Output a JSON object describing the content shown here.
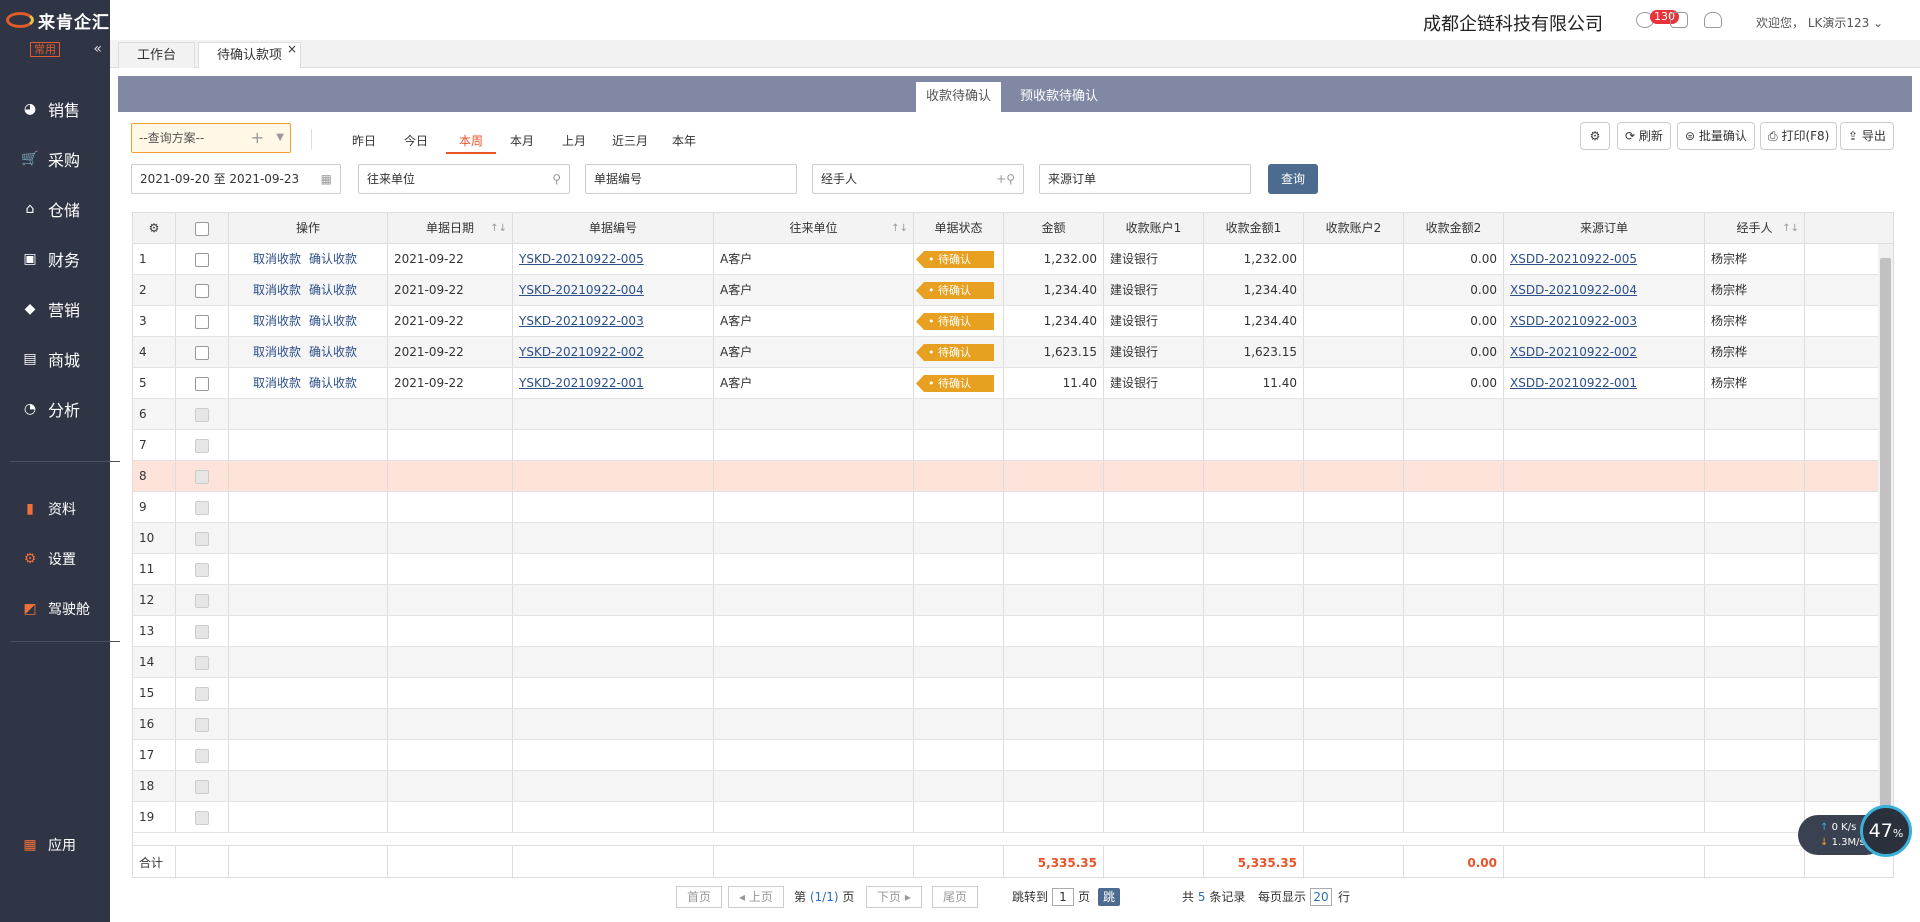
{
  "sidebar": {
    "logo": "来肯企汇",
    "fav": "常用",
    "items": [
      {
        "label": "销售",
        "icon": "sales-icon"
      },
      {
        "label": "采购",
        "icon": "purchase-icon"
      },
      {
        "label": "仓储",
        "icon": "warehouse-icon"
      },
      {
        "label": "财务",
        "icon": "finance-icon"
      },
      {
        "label": "营销",
        "icon": "marketing-icon"
      },
      {
        "label": "商城",
        "icon": "mall-icon"
      },
      {
        "label": "分析",
        "icon": "analysis-icon"
      }
    ],
    "items2": [
      {
        "label": "资料"
      },
      {
        "label": "设置"
      },
      {
        "label": "驾驶舱"
      }
    ],
    "app": "应用"
  },
  "header": {
    "company": "成都企链科技有限公司",
    "msg_count": "130",
    "welcome": "欢迎您，",
    "user": "LK演示123"
  },
  "tabs": [
    {
      "label": "工作台"
    },
    {
      "label": "待确认款项"
    }
  ],
  "panel_tabs": [
    {
      "label": "收款待确认"
    },
    {
      "label": "预收款待确认"
    }
  ],
  "toolbar": {
    "scheme": "--查询方案--",
    "quick": [
      "昨日",
      "今日",
      "本周",
      "本月",
      "上月",
      "近三月",
      "本年"
    ],
    "refresh": "刷新",
    "batch": "批量确认",
    "print": "打印(F8)",
    "export": "导出"
  },
  "filters": {
    "date_from": "2021-09-20",
    "date_sep": "至",
    "date_to": "2021-09-23",
    "partner": "往来单位",
    "bill_no": "单据编号",
    "handler": "经手人",
    "source": "来源订单",
    "query": "查询"
  },
  "columns": [
    "操作",
    "单据日期",
    "单据编号",
    "往来单位",
    "单据状态",
    "金额",
    "收款账户1",
    "收款金额1",
    "收款账户2",
    "收款金额2",
    "来源订单",
    "经手人"
  ],
  "actions": {
    "cancel": "取消收款",
    "confirm": "确认收款"
  },
  "rows": [
    {
      "date": "2021-09-22",
      "no": "YSKD-20210922-005",
      "partner": "A客户",
      "status": "待确认",
      "amount": "1,232.00",
      "acc1": "建设银行",
      "amt1": "1,232.00",
      "amt2": "0.00",
      "source": "XSDD-20210922-005",
      "handler": "杨宗桦"
    },
    {
      "date": "2021-09-22",
      "no": "YSKD-20210922-004",
      "partner": "A客户",
      "status": "待确认",
      "amount": "1,234.40",
      "acc1": "建设银行",
      "amt1": "1,234.40",
      "amt2": "0.00",
      "source": "XSDD-20210922-004",
      "handler": "杨宗桦"
    },
    {
      "date": "2021-09-22",
      "no": "YSKD-20210922-003",
      "partner": "A客户",
      "status": "待确认",
      "amount": "1,234.40",
      "acc1": "建设银行",
      "amt1": "1,234.40",
      "amt2": "0.00",
      "source": "XSDD-20210922-003",
      "handler": "杨宗桦"
    },
    {
      "date": "2021-09-22",
      "no": "YSKD-20210922-002",
      "partner": "A客户",
      "status": "待确认",
      "amount": "1,623.15",
      "acc1": "建设银行",
      "amt1": "1,623.15",
      "amt2": "0.00",
      "source": "XSDD-20210922-002",
      "handler": "杨宗桦"
    },
    {
      "date": "2021-09-22",
      "no": "YSKD-20210922-001",
      "partner": "A客户",
      "status": "待确认",
      "amount": "11.40",
      "acc1": "建设银行",
      "amt1": "11.40",
      "amt2": "0.00",
      "source": "XSDD-20210922-001",
      "handler": "杨宗桦"
    }
  ],
  "row_numbers": [
    "1",
    "2",
    "3",
    "4",
    "5",
    "6",
    "7",
    "8",
    "9",
    "10",
    "11",
    "12",
    "13",
    "14",
    "15",
    "16",
    "17",
    "18",
    "19"
  ],
  "footer": {
    "label": "合计",
    "amount": "5,335.35",
    "amt1": "5,335.35",
    "amt2": "0.00"
  },
  "pager": {
    "first": "首页",
    "prev": "上页",
    "page_prefix": "第",
    "page_info": "(1/1)",
    "page_suffix": "页",
    "next": "下页",
    "last": "尾页",
    "jump_to": "跳转到",
    "jump_page": "1",
    "jump_suffix": "页",
    "jump": "跳转",
    "total_prefix": "共",
    "total": "5",
    "total_suffix": "条记录",
    "per_page_label": "每页显示",
    "per_page": "20",
    "per_page_suffix": "行"
  },
  "speed": {
    "up": "0",
    "up_unit": "K/s",
    "down": "1.3",
    "down_unit": "M/s",
    "percent": "47",
    "percent_unit": "%"
  }
}
